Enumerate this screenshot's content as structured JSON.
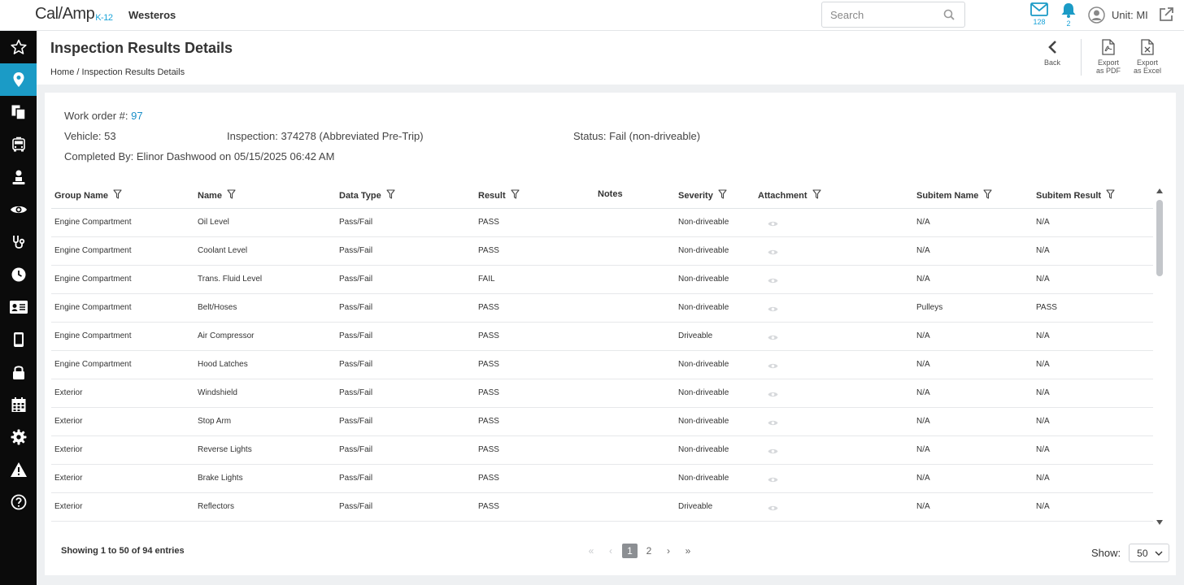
{
  "brand": {
    "name": "Cal/Amp",
    "suffix": "K-12"
  },
  "org_name": "Westeros",
  "search": {
    "placeholder": "Search",
    "value": ""
  },
  "notifications": {
    "mail_count": "128",
    "alert_count": "2"
  },
  "user": {
    "label": "Unit: MI"
  },
  "sidebar": {
    "items": [
      {
        "icon": "star-icon"
      },
      {
        "icon": "location-pin-icon",
        "active": true
      },
      {
        "icon": "documents-icon"
      },
      {
        "icon": "bus-icon"
      },
      {
        "icon": "driver-icon"
      },
      {
        "icon": "eye-icon"
      },
      {
        "icon": "stethoscope-icon"
      },
      {
        "icon": "clock-icon"
      },
      {
        "icon": "id-card-icon"
      },
      {
        "icon": "tablet-icon"
      },
      {
        "icon": "lock-icon"
      },
      {
        "icon": "calendar-icon"
      },
      {
        "icon": "gear-icon"
      },
      {
        "icon": "warning-icon"
      },
      {
        "icon": "help-icon"
      }
    ]
  },
  "page": {
    "title": "Inspection Results Details",
    "breadcrumb": "Home / Inspection Results Details"
  },
  "actions": {
    "back": "Back",
    "export_pdf_1": "Export",
    "export_pdf_2": "as PDF",
    "export_excel_1": "Export",
    "export_excel_2": "as Excel"
  },
  "details": {
    "work_order_label": "Work order #:",
    "work_order_value": "97",
    "vehicle": "Vehicle: 53",
    "inspection": "Inspection: 374278 (Abbreviated Pre-Trip)",
    "status": "Status: Fail (non-driveable)",
    "completed": "Completed By: Elinor Dashwood on 05/15/2025 06:42 AM"
  },
  "table": {
    "columns": [
      "Group Name",
      "Name",
      "Data Type",
      "Result",
      "Notes",
      "Severity",
      "Attachment",
      "Subitem Name",
      "Subitem Result"
    ],
    "rows": [
      [
        "Engine Compartment",
        "Oil Level",
        "Pass/Fail",
        "PASS",
        "",
        "Non-driveable",
        "",
        "N/A",
        "N/A"
      ],
      [
        "Engine Compartment",
        "Coolant Level",
        "Pass/Fail",
        "PASS",
        "",
        "Non-driveable",
        "",
        "N/A",
        "N/A"
      ],
      [
        "Engine Compartment",
        "Trans. Fluid Level",
        "Pass/Fail",
        "FAIL",
        "",
        "Non-driveable",
        "",
        "N/A",
        "N/A"
      ],
      [
        "Engine Compartment",
        "Belt/Hoses",
        "Pass/Fail",
        "PASS",
        "",
        "Non-driveable",
        "",
        "Pulleys",
        "PASS"
      ],
      [
        "Engine Compartment",
        "Air Compressor",
        "Pass/Fail",
        "PASS",
        "",
        "Driveable",
        "",
        "N/A",
        "N/A"
      ],
      [
        "Engine Compartment",
        "Hood Latches",
        "Pass/Fail",
        "PASS",
        "",
        "Non-driveable",
        "",
        "N/A",
        "N/A"
      ],
      [
        "Exterior",
        "Windshield",
        "Pass/Fail",
        "PASS",
        "",
        "Non-driveable",
        "",
        "N/A",
        "N/A"
      ],
      [
        "Exterior",
        "Stop Arm",
        "Pass/Fail",
        "PASS",
        "",
        "Non-driveable",
        "",
        "N/A",
        "N/A"
      ],
      [
        "Exterior",
        "Reverse Lights",
        "Pass/Fail",
        "PASS",
        "",
        "Non-driveable",
        "",
        "N/A",
        "N/A"
      ],
      [
        "Exterior",
        "Brake Lights",
        "Pass/Fail",
        "PASS",
        "",
        "Non-driveable",
        "",
        "N/A",
        "N/A"
      ],
      [
        "Exterior",
        "Reflectors",
        "Pass/Fail",
        "PASS",
        "",
        "Driveable",
        "",
        "N/A",
        "N/A"
      ]
    ]
  },
  "pagination": {
    "summary": "Showing 1 to 50 of 94 entries",
    "pages": [
      "1",
      "2"
    ],
    "current": "1",
    "show_label": "Show:",
    "page_size": "50"
  },
  "colors": {
    "accent": "#1b9bc6",
    "sidebar_bg": "#0b0b0b"
  }
}
